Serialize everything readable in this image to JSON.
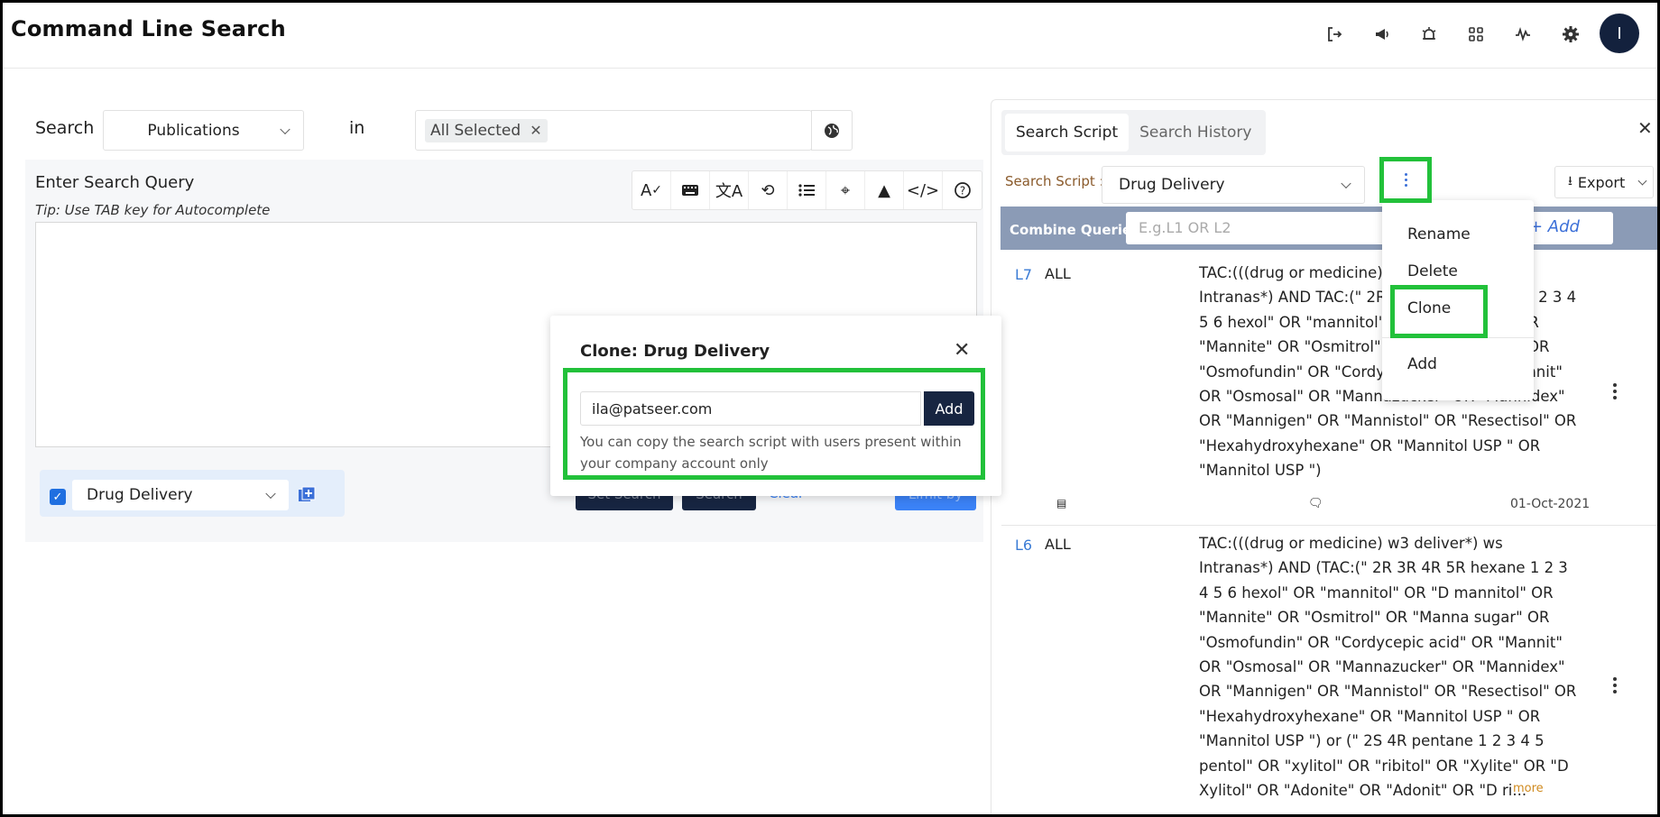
{
  "header": {
    "title": "Command Line Search",
    "avatar_initial": "I"
  },
  "search": {
    "label": "Search",
    "source_value": "Publications",
    "in_label": "in",
    "collection_tag": "All Selected",
    "query_label": "Enter Search Query",
    "tip": "Tip: Use TAB key for Autocomplete"
  },
  "script_bar": {
    "selected_script": "Drug Delivery",
    "bg_button_1": "Set Search",
    "bg_button_2": "Search",
    "bg_link": "Clear",
    "bg_button_3": "Limit by"
  },
  "clone_modal": {
    "title": "Clone: Drug Delivery",
    "email_value": "ila@patseer.com",
    "add_label": "Add",
    "hint": "You can copy the search script with users present within your company account only"
  },
  "right_panel": {
    "tabs": [
      "Search Script",
      "Search History"
    ],
    "script_label": "Search Script :",
    "script_value": "Drug Delivery",
    "export_label": "Export",
    "combine_label": "Combine Queries",
    "combine_placeholder": "E.g.L1 OR L2",
    "add_link": "+ Add",
    "queries": [
      {
        "id": "L7",
        "field": "ALL",
        "text": "TAC:(((drug or medicine) w3 deliver*) ws Intranas*) AND TAC:(\" 2R 3R 4R 5R hexane 1 2 3 4 5 6 hexol\" OR \"mannitol\" OR \"D mannitol\" OR \"Mannite\" OR \"Osmitrol\" OR \"Manna sugar\" OR \"Osmofundin\" OR \"Cordycepic acid\" OR \"Mannit\" OR \"Osmosal\" OR \"Mannazucker\" OR \"Mannidex\" OR \"Mannigen\" OR \"Mannistol\" OR \"Resectisol\" OR \"Hexahydroxyhexane\" OR \"Mannitol USP \" OR \"Mannitol USP \")",
        "date": "01-Oct-2021"
      },
      {
        "id": "L6",
        "field": "ALL",
        "text": "TAC:(((drug or medicine) w3 deliver*) ws Intranas*) AND (TAC:(\" 2R 3R 4R 5R hexane 1 2 3 4 5 6 hexol\" OR \"mannitol\" OR \"D mannitol\" OR \"Mannite\" OR \"Osmitrol\" OR \"Manna sugar\" OR \"Osmofundin\" OR \"Cordycepic acid\" OR \"Mannit\" OR \"Osmosal\" OR \"Mannazucker\" OR \"Mannidex\" OR \"Mannigen\" OR \"Mannistol\" OR \"Resectisol\" OR \"Hexahydroxyhexane\" OR \"Mannitol USP \" OR \"Mannitol USP \") or (\" 2S 4R pentane 1 2 3 4 5 pentol\" OR \"xylitol\" OR \"ribitol\" OR \"Xylite\" OR \"D Xylitol\" OR \"Adonite\" OR \"Adonit\" OR \"D ri...",
        "more_label": "more"
      }
    ]
  },
  "context_menu": {
    "items": [
      "Rename",
      "Delete",
      "Clone",
      "Add"
    ]
  },
  "colors": {
    "highlight": "#22c13a",
    "navy": "#172541",
    "link_blue": "#3a7bd5"
  }
}
